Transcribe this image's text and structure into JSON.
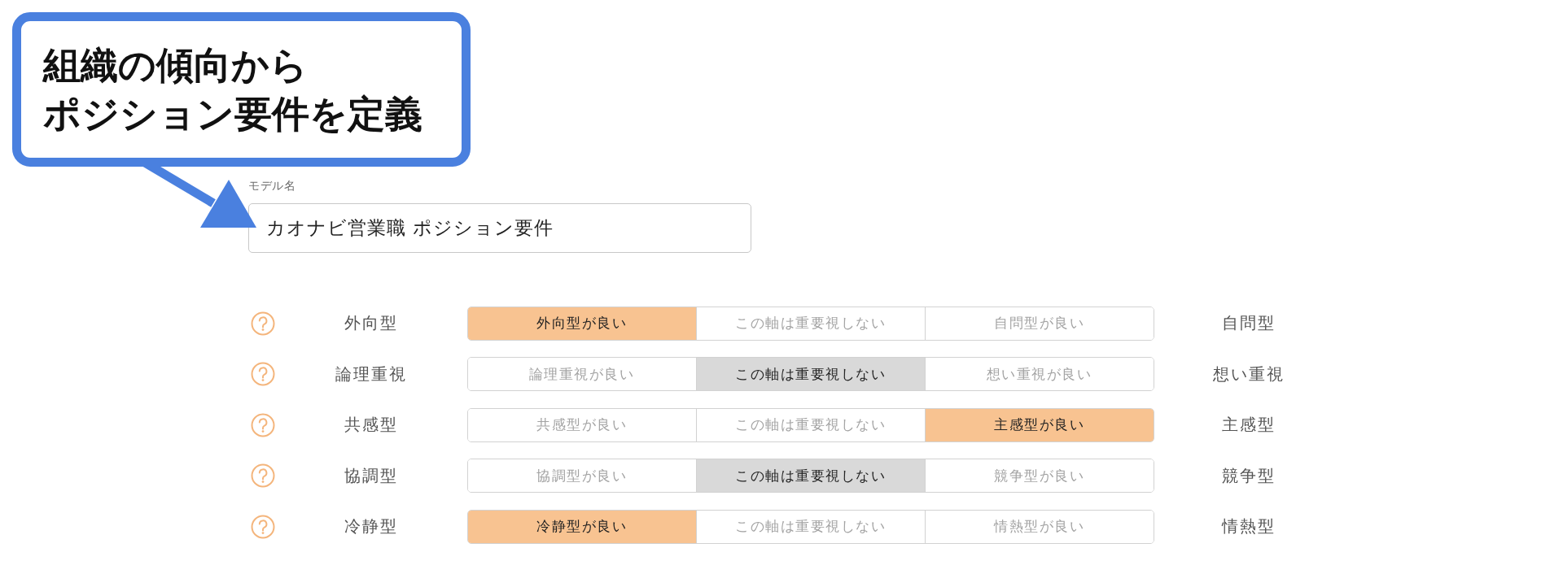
{
  "callout": {
    "lines": [
      "組織の傾向から",
      "ポジション要件を定義"
    ]
  },
  "model_name": {
    "label": "モデル名",
    "value": "カオナビ営業職 ポジション要件"
  },
  "axes": [
    {
      "left_label": "外向型",
      "options": [
        {
          "label": "外向型が良い",
          "selected": true
        },
        {
          "label": "この軸は重要視しない",
          "selected": false
        },
        {
          "label": "自問型が良い",
          "selected": false
        }
      ],
      "right_label": "自問型"
    },
    {
      "left_label": "論理重視",
      "options": [
        {
          "label": "論理重視が良い",
          "selected": false
        },
        {
          "label": "この軸は重要視しない",
          "selected": true
        },
        {
          "label": "想い重視が良い",
          "selected": false
        }
      ],
      "right_label": "想い重視"
    },
    {
      "left_label": "共感型",
      "options": [
        {
          "label": "共感型が良い",
          "selected": false
        },
        {
          "label": "この軸は重要視しない",
          "selected": false
        },
        {
          "label": "主感型が良い",
          "selected": true
        }
      ],
      "right_label": "主感型"
    },
    {
      "left_label": "協調型",
      "options": [
        {
          "label": "協調型が良い",
          "selected": false
        },
        {
          "label": "この軸は重要視しない",
          "selected": true
        },
        {
          "label": "競争型が良い",
          "selected": false
        }
      ],
      "right_label": "競争型"
    },
    {
      "left_label": "冷静型",
      "options": [
        {
          "label": "冷静型が良い",
          "selected": true
        },
        {
          "label": "この軸は重要視しない",
          "selected": false
        },
        {
          "label": "情熱型が良い",
          "selected": false
        }
      ],
      "right_label": "情熱型"
    }
  ]
}
